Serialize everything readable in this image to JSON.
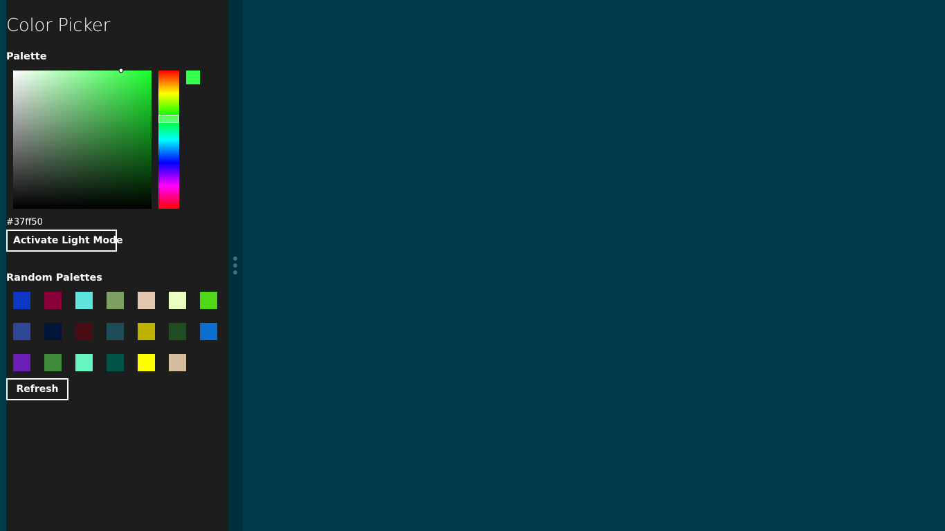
{
  "app": {
    "title": "Color Picker"
  },
  "picker": {
    "section_label": "Palette",
    "hex": "#37ff50",
    "selected_color": "#37ff50",
    "hue_color": "#1aff2e",
    "hue_degrees": 126,
    "saturation": 0.78,
    "brightness": 1.0
  },
  "theme_toggle": {
    "label": "Activate Light Mode"
  },
  "random_palettes": {
    "section_label": "Random Palettes",
    "swatches": [
      [
        "#0f37c6",
        "#8a0038",
        "#5fe4dc",
        "#7da164",
        "#e2c6ad",
        "#e9ffbf",
        "#4fd818"
      ],
      [
        "#324696",
        "#001538",
        "#4b0b16",
        "#1e4d57",
        "#c0b300",
        "#224d22",
        "#0c6ecf"
      ],
      [
        "#6a1fb4",
        "#418a3a",
        "#66f6bf",
        "#005346",
        "#ffff00",
        "#d3be9f"
      ]
    ],
    "refresh_label": "Refresh"
  },
  "colors": {
    "sidebar_bg": "#1d1d1d",
    "main_bg": "#003b4a",
    "splitter_bg": "#002f3b",
    "text": "#ffffff"
  },
  "icons": {
    "splitter_grip": "three-dot-vertical-grip"
  }
}
